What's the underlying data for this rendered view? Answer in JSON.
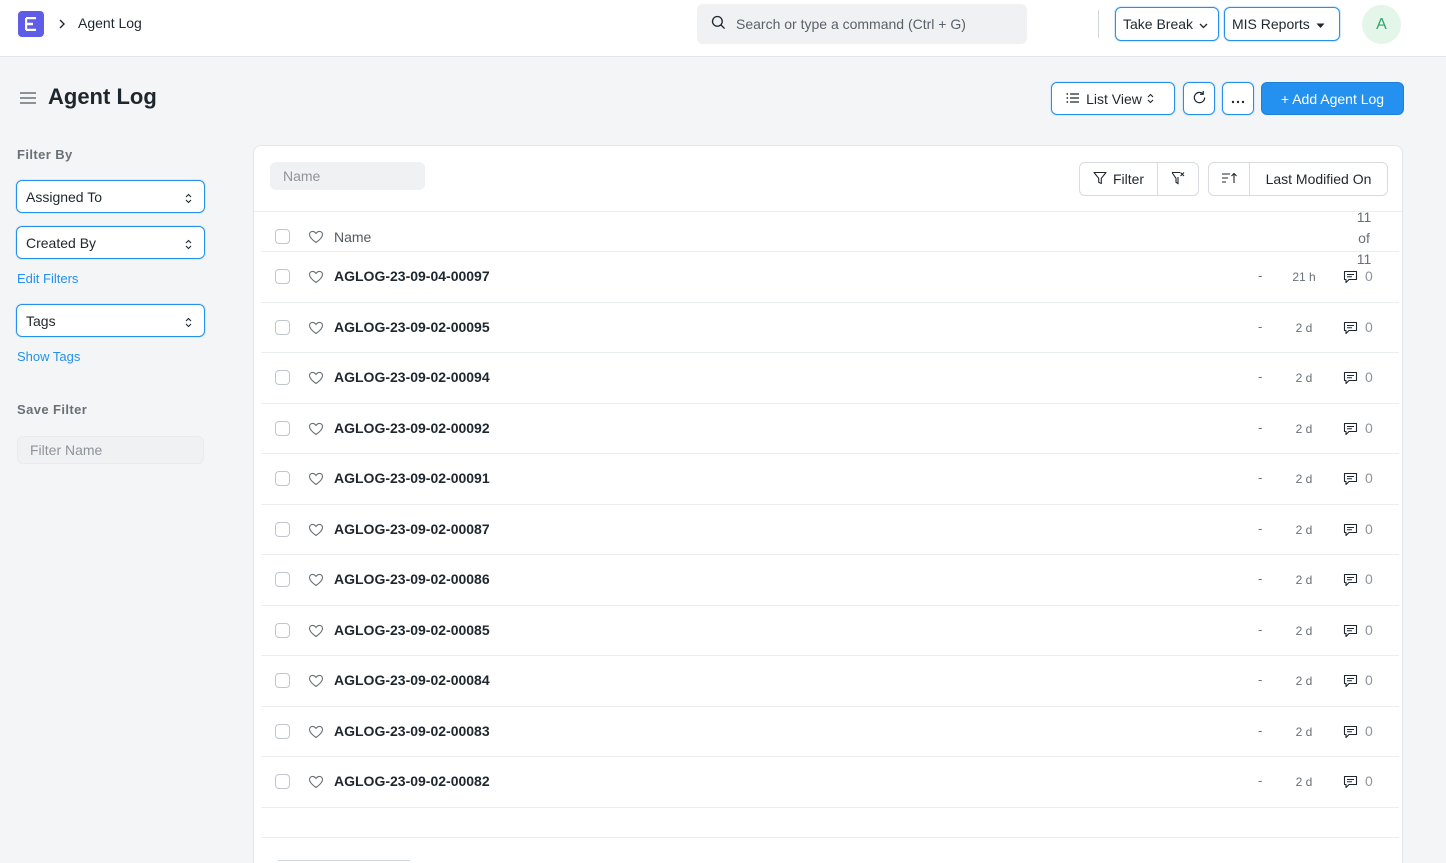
{
  "navbar": {
    "breadcrumb": "Agent Log",
    "search_placeholder": "Search or type a command (Ctrl + G)",
    "take_break_label": "Take Break",
    "mis_reports_label": "MIS Reports",
    "avatar_initial": "A"
  },
  "page": {
    "title": "Agent Log",
    "list_view_label": "List View",
    "add_label": "+ Add Agent Log"
  },
  "sidebar": {
    "filter_by_heading": "Filter By",
    "assigned_to_label": "Assigned To",
    "created_by_label": "Created By",
    "edit_filters_label": "Edit Filters",
    "tags_label": "Tags",
    "show_tags_label": "Show Tags",
    "save_filter_heading": "Save Filter",
    "filter_name_placeholder": "Filter Name"
  },
  "list": {
    "name_placeholder": "Name",
    "filter_label": "Filter",
    "sort_label": "Last Modified On",
    "column_name": "Name",
    "count_lines": [
      "11",
      "of",
      "11"
    ],
    "rows": [
      {
        "name": "AGLOG-23-09-04-00097",
        "status": "-",
        "modified": "21 h",
        "comments": "0"
      },
      {
        "name": "AGLOG-23-09-02-00095",
        "status": "-",
        "modified": "2 d",
        "comments": "0"
      },
      {
        "name": "AGLOG-23-09-02-00094",
        "status": "-",
        "modified": "2 d",
        "comments": "0"
      },
      {
        "name": "AGLOG-23-09-02-00092",
        "status": "-",
        "modified": "2 d",
        "comments": "0"
      },
      {
        "name": "AGLOG-23-09-02-00091",
        "status": "-",
        "modified": "2 d",
        "comments": "0"
      },
      {
        "name": "AGLOG-23-09-02-00087",
        "status": "-",
        "modified": "2 d",
        "comments": "0"
      },
      {
        "name": "AGLOG-23-09-02-00086",
        "status": "-",
        "modified": "2 d",
        "comments": "0"
      },
      {
        "name": "AGLOG-23-09-02-00085",
        "status": "-",
        "modified": "2 d",
        "comments": "0"
      },
      {
        "name": "AGLOG-23-09-02-00084",
        "status": "-",
        "modified": "2 d",
        "comments": "0"
      },
      {
        "name": "AGLOG-23-09-02-00083",
        "status": "-",
        "modified": "2 d",
        "comments": "0"
      },
      {
        "name": "AGLOG-23-09-02-00082",
        "status": "-",
        "modified": "2 d",
        "comments": "0"
      }
    ]
  },
  "icons": {
    "app_logo": "frappe-logo-icon",
    "breadcrumb_separator": "chevron-right-icon",
    "search": "search-icon",
    "sidebar_toggle": "hamburger-icon",
    "list_view": "list-icon",
    "refresh": "refresh-icon",
    "more": "ellipsis-icon",
    "filter": "filter-icon",
    "clear_filter": "filter-x-icon",
    "sort_direction": "sort-ascending-icon",
    "like": "heart-icon",
    "comment": "comment-icon",
    "select_updown": "chevron-updown-icon"
  },
  "colors": {
    "primary": "#2490ef",
    "logo": "#5f5ce8",
    "avatar_bg": "#e4f5e9",
    "avatar_text": "#30a66d"
  }
}
